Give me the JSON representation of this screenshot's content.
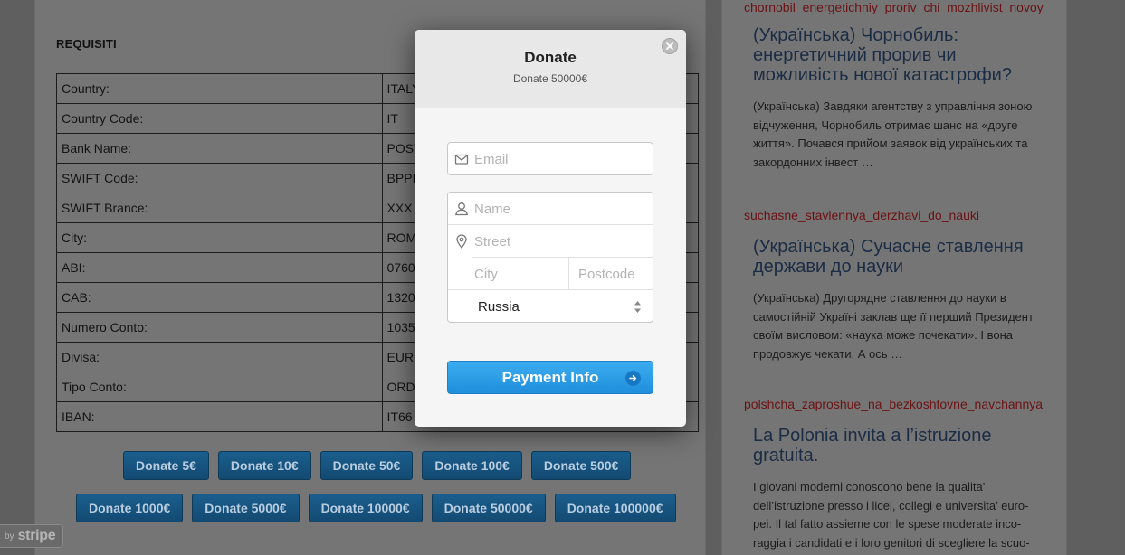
{
  "page": {
    "section_heading": "REQUISITI",
    "requisites": [
      {
        "key": "Country:",
        "value": "ITALY"
      },
      {
        "key": "Country Code:",
        "value": "IT"
      },
      {
        "key": "Bank Name:",
        "value": "POST"
      },
      {
        "key": "SWIFT Code:",
        "value": "BPPI"
      },
      {
        "key": "SWIFT Brance:",
        "value": "XXX"
      },
      {
        "key": "City:",
        "value": "ROM"
      },
      {
        "key": "ABI:",
        "value": "0760"
      },
      {
        "key": "CAB:",
        "value": "1320"
      },
      {
        "key": "Numero Conto:",
        "value": "1035"
      },
      {
        "key": "Divisa:",
        "value": "EUR"
      },
      {
        "key": "Tipo Conto:",
        "value": "ORD"
      },
      {
        "key": "IBAN:",
        "value": "IT66"
      }
    ],
    "donate_buttons_row1": [
      "Donate 5€",
      "Donate 10€",
      "Donate 50€",
      "Donate 100€",
      "Donate 500€"
    ],
    "donate_buttons_row2": [
      "Donate 1000€",
      "Donate 5000€",
      "Donate 10000€",
      "Donate 50000€",
      "Donate 100000€"
    ],
    "stripe_badge": {
      "prefix": "by",
      "brand": "stripe"
    }
  },
  "sidebar": {
    "posts": [
      {
        "slug": "chornobil_energetichniy_proriv_chi_mozhlivist_novoy",
        "title": "(Українська) Чорнобиль: енергетичний прорив чи можливість нової катастрофи?",
        "excerpt": "(Українська) Завдяки агентству з управління зоною відчуження, Чорнобиль отримає шанс на «друге життя». Почався прийом заявок від українських та закордонних інвест …"
      },
      {
        "slug": "suchasne_stavlennya_derzhavi_do_nauki",
        "title": "(Українська) Сучасне ставлення держави до науки",
        "excerpt": "(Українська) Другорядне ставлення до науки в самостійній Україні заклав ще її перший Президент своїм висловом: «наука може почекати». І вона продовжує чекати. А ось …"
      },
      {
        "slug": "polshcha_zaproshue_na_bezkoshtovne_navchannya",
        "title": "La Polonia invita a l’istruzione gratuita.",
        "excerpt": "I giovani moderni conoscono bene la qualita’ dell’istruzione presso i licei, collegi e universita’ euro-pei. Il tal fatto assieme con le spese moderate inco-raggia i candidati e i loro genitori di scegliere la scuo-"
      }
    ]
  },
  "modal": {
    "title": "Donate",
    "subtitle": "Donate 50000€",
    "email_placeholder": "Email",
    "name_placeholder": "Name",
    "street_placeholder": "Street",
    "city_placeholder": "City",
    "postcode_placeholder": "Postcode",
    "country_selected": "Russia",
    "submit_label": "Payment Info"
  },
  "colors": {
    "overlay": "#5f5f5f",
    "pay_button": "#2a9be6",
    "donate_button": "#1b5e8d",
    "slug_link": "#6d1212"
  }
}
